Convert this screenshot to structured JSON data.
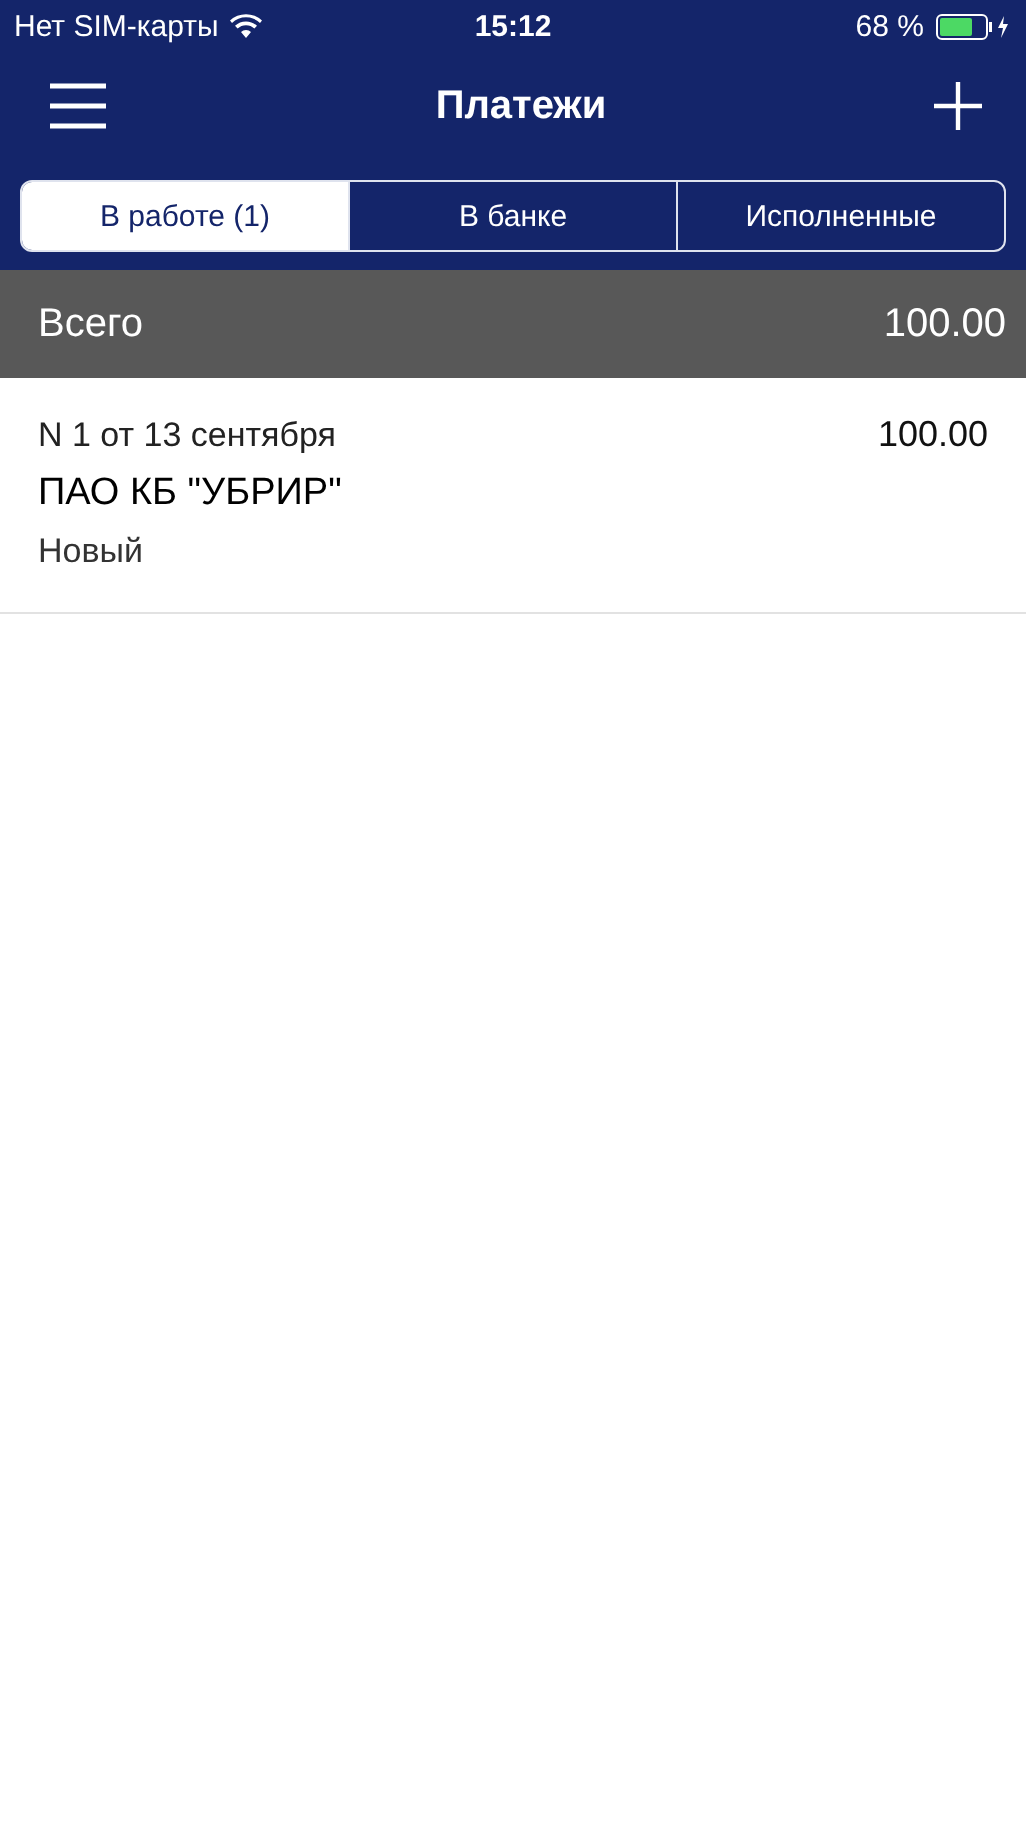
{
  "status_bar": {
    "carrier": "Нет SIM-карты",
    "time": "15:12",
    "battery": "68 %"
  },
  "nav": {
    "title": "Платежи"
  },
  "tabs": [
    {
      "label": "В работе (1)",
      "selected": true
    },
    {
      "label": "В банке",
      "selected": false
    },
    {
      "label": "Исполненные",
      "selected": false
    }
  ],
  "total": {
    "label": "Всего",
    "amount": "100.00"
  },
  "payments": [
    {
      "number": "N 1 от 13 сентября",
      "amount": "100.00",
      "bank": "ПАО КБ \"УБРИР\"",
      "status": "Новый"
    }
  ]
}
